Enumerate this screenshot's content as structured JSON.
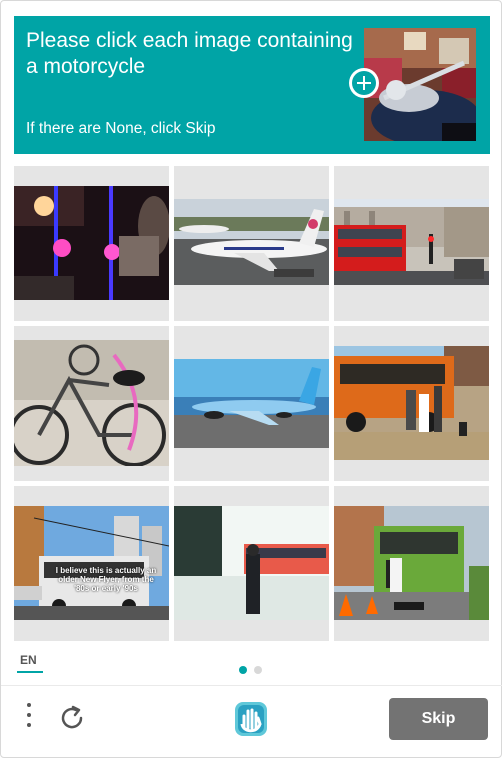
{
  "header": {
    "title": "Please click each image containing a motorcycle",
    "subtitle": "If there are None, click Skip",
    "bg_color": "#00a4a6",
    "sample_icon": "plus-icon"
  },
  "grid": {
    "tiles": [
      {
        "name": "tile-night-lights",
        "scene": "night street with glowing lights"
      },
      {
        "name": "tile-airplane-airport",
        "scene": "airliner on tarmac"
      },
      {
        "name": "tile-red-bus-street",
        "scene": "red double decker bus on street"
      },
      {
        "name": "tile-bicycles",
        "scene": "parked bicycles"
      },
      {
        "name": "tile-airplane-sea",
        "scene": "airliner on runway by the sea"
      },
      {
        "name": "tile-orange-bus",
        "scene": "orange bus with people"
      },
      {
        "name": "tile-trolley-bus",
        "scene": "trolley bus with caption"
      },
      {
        "name": "tile-bus-person",
        "scene": "person walking near bus"
      },
      {
        "name": "tile-green-bus",
        "scene": "green bus with cones"
      }
    ],
    "tile3_caption": "I believe this is actually an older New Flyer, from the '80s or early '90s"
  },
  "footer": {
    "language": "EN",
    "page_dots": [
      "active",
      "inactive"
    ],
    "accent_color": "#00a4a6",
    "menu_icon": "more-vertical-icon",
    "refresh_icon": "refresh-icon",
    "logo_icon": "hand-logo-icon",
    "skip_label": "Skip"
  }
}
